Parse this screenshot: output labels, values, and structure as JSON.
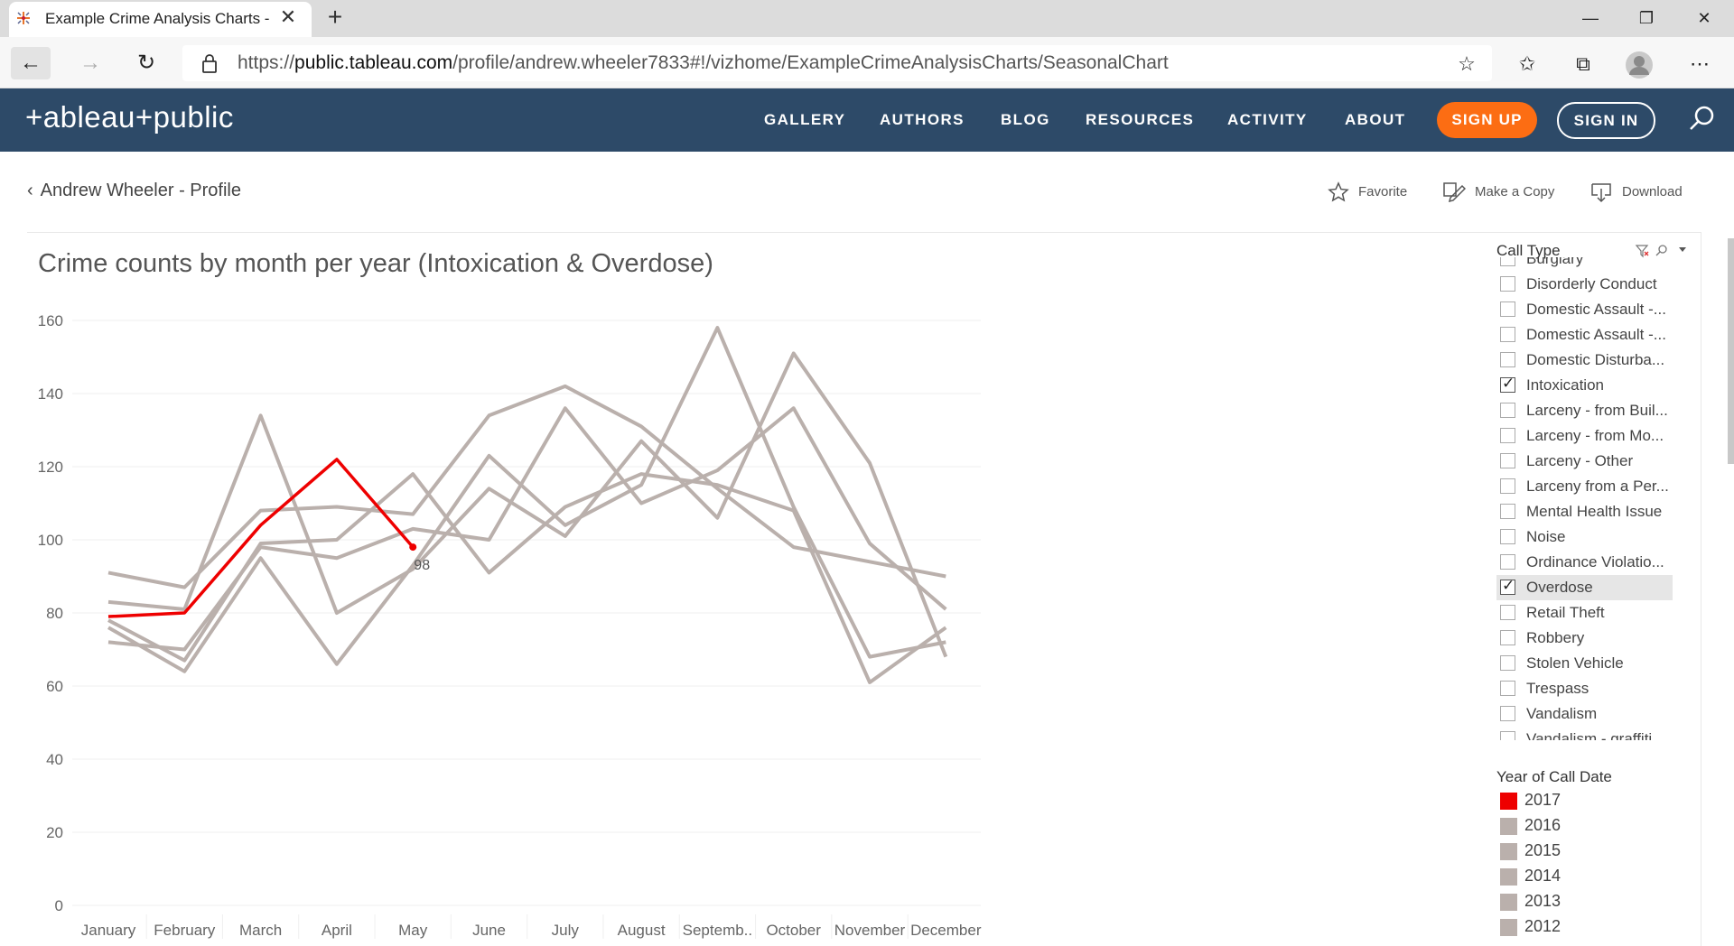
{
  "browser": {
    "tab_title": "Example Crime Analysis Charts -",
    "url_prefix": "https://",
    "url_host": "public.tableau.com",
    "url_path": "/profile/andrew.wheeler7833#!/vizhome/ExampleCrimeAnalysisCharts/SeasonalChart"
  },
  "header": {
    "logo": "+ableau+public",
    "nav": [
      "GALLERY",
      "AUTHORS",
      "BLOG",
      "RESOURCES",
      "ACTIVITY",
      "ABOUT"
    ],
    "signup": "SIGN UP",
    "signin": "SIGN IN",
    "colors": {
      "bar": "#2d4a68",
      "signup": "#fc6d13"
    }
  },
  "profile_bar": {
    "back": "Andrew Wheeler - Profile",
    "favorite": "Favorite",
    "make_copy": "Make a Copy",
    "download": "Download"
  },
  "filters": {
    "call_type_title": "Call Type",
    "items": [
      {
        "label": "Burglary",
        "checked": false
      },
      {
        "label": "Disorderly Conduct",
        "checked": false
      },
      {
        "label": "Domestic Assault -...",
        "checked": false
      },
      {
        "label": "Domestic Assault -...",
        "checked": false
      },
      {
        "label": "Domestic Disturba...",
        "checked": false
      },
      {
        "label": "Intoxication",
        "checked": true
      },
      {
        "label": "Larceny - from Buil...",
        "checked": false
      },
      {
        "label": "Larceny - from Mo...",
        "checked": false
      },
      {
        "label": "Larceny - Other",
        "checked": false
      },
      {
        "label": "Larceny from a Per...",
        "checked": false
      },
      {
        "label": "Mental Health Issue",
        "checked": false
      },
      {
        "label": "Noise",
        "checked": false
      },
      {
        "label": "Ordinance Violatio...",
        "checked": false
      },
      {
        "label": "Overdose",
        "checked": true,
        "highlighted": true
      },
      {
        "label": "Retail Theft",
        "checked": false
      },
      {
        "label": "Robbery",
        "checked": false
      },
      {
        "label": "Stolen Vehicle",
        "checked": false
      },
      {
        "label": "Trespass",
        "checked": false
      },
      {
        "label": "Vandalism",
        "checked": false
      },
      {
        "label": "Vandalism - graffiti",
        "checked": false
      }
    ]
  },
  "legend": {
    "title": "Year of Call Date",
    "items": [
      {
        "label": "2017",
        "color": "#ee0000"
      },
      {
        "label": "2016",
        "color": "#bab0ac"
      },
      {
        "label": "2015",
        "color": "#bab0ac"
      },
      {
        "label": "2014",
        "color": "#bab0ac"
      },
      {
        "label": "2013",
        "color": "#bab0ac"
      },
      {
        "label": "2012",
        "color": "#bab0ac"
      }
    ]
  },
  "chart_data": {
    "type": "line",
    "title": "Crime counts by month per year (Intoxication & Overdose)",
    "categories": [
      "January",
      "February",
      "March",
      "April",
      "May",
      "June",
      "July",
      "August",
      "Septemb..",
      "October",
      "November",
      "December"
    ],
    "ylim": [
      0,
      160
    ],
    "yticks": [
      0,
      20,
      40,
      60,
      80,
      100,
      120,
      140,
      160
    ],
    "grid": true,
    "series": [
      {
        "name": "2012",
        "color": "#bab0ac",
        "values": [
          91,
          87,
          108,
          109,
          107,
          134,
          142,
          131,
          114,
          98,
          94,
          90
        ]
      },
      {
        "name": "2013",
        "color": "#bab0ac",
        "values": [
          83,
          81,
          134,
          80,
          92,
          114,
          101,
          127,
          106,
          151,
          121,
          68
        ]
      },
      {
        "name": "2014",
        "color": "#bab0ac",
        "values": [
          78,
          67,
          99,
          100,
          118,
          91,
          109,
          118,
          115,
          108,
          61,
          76
        ]
      },
      {
        "name": "2015",
        "color": "#bab0ac",
        "values": [
          76,
          64,
          95,
          66,
          93,
          123,
          104,
          115,
          158,
          109,
          68,
          72
        ]
      },
      {
        "name": "2016",
        "color": "#bab0ac",
        "values": [
          72,
          70,
          98,
          95,
          103,
          100,
          136,
          110,
          119,
          136,
          99,
          81
        ]
      },
      {
        "name": "2017",
        "color": "#ee0000",
        "values": [
          79,
          80,
          104,
          122,
          98
        ]
      }
    ],
    "annotations": [
      {
        "series": "2017",
        "category": "May",
        "text": "98"
      }
    ]
  }
}
